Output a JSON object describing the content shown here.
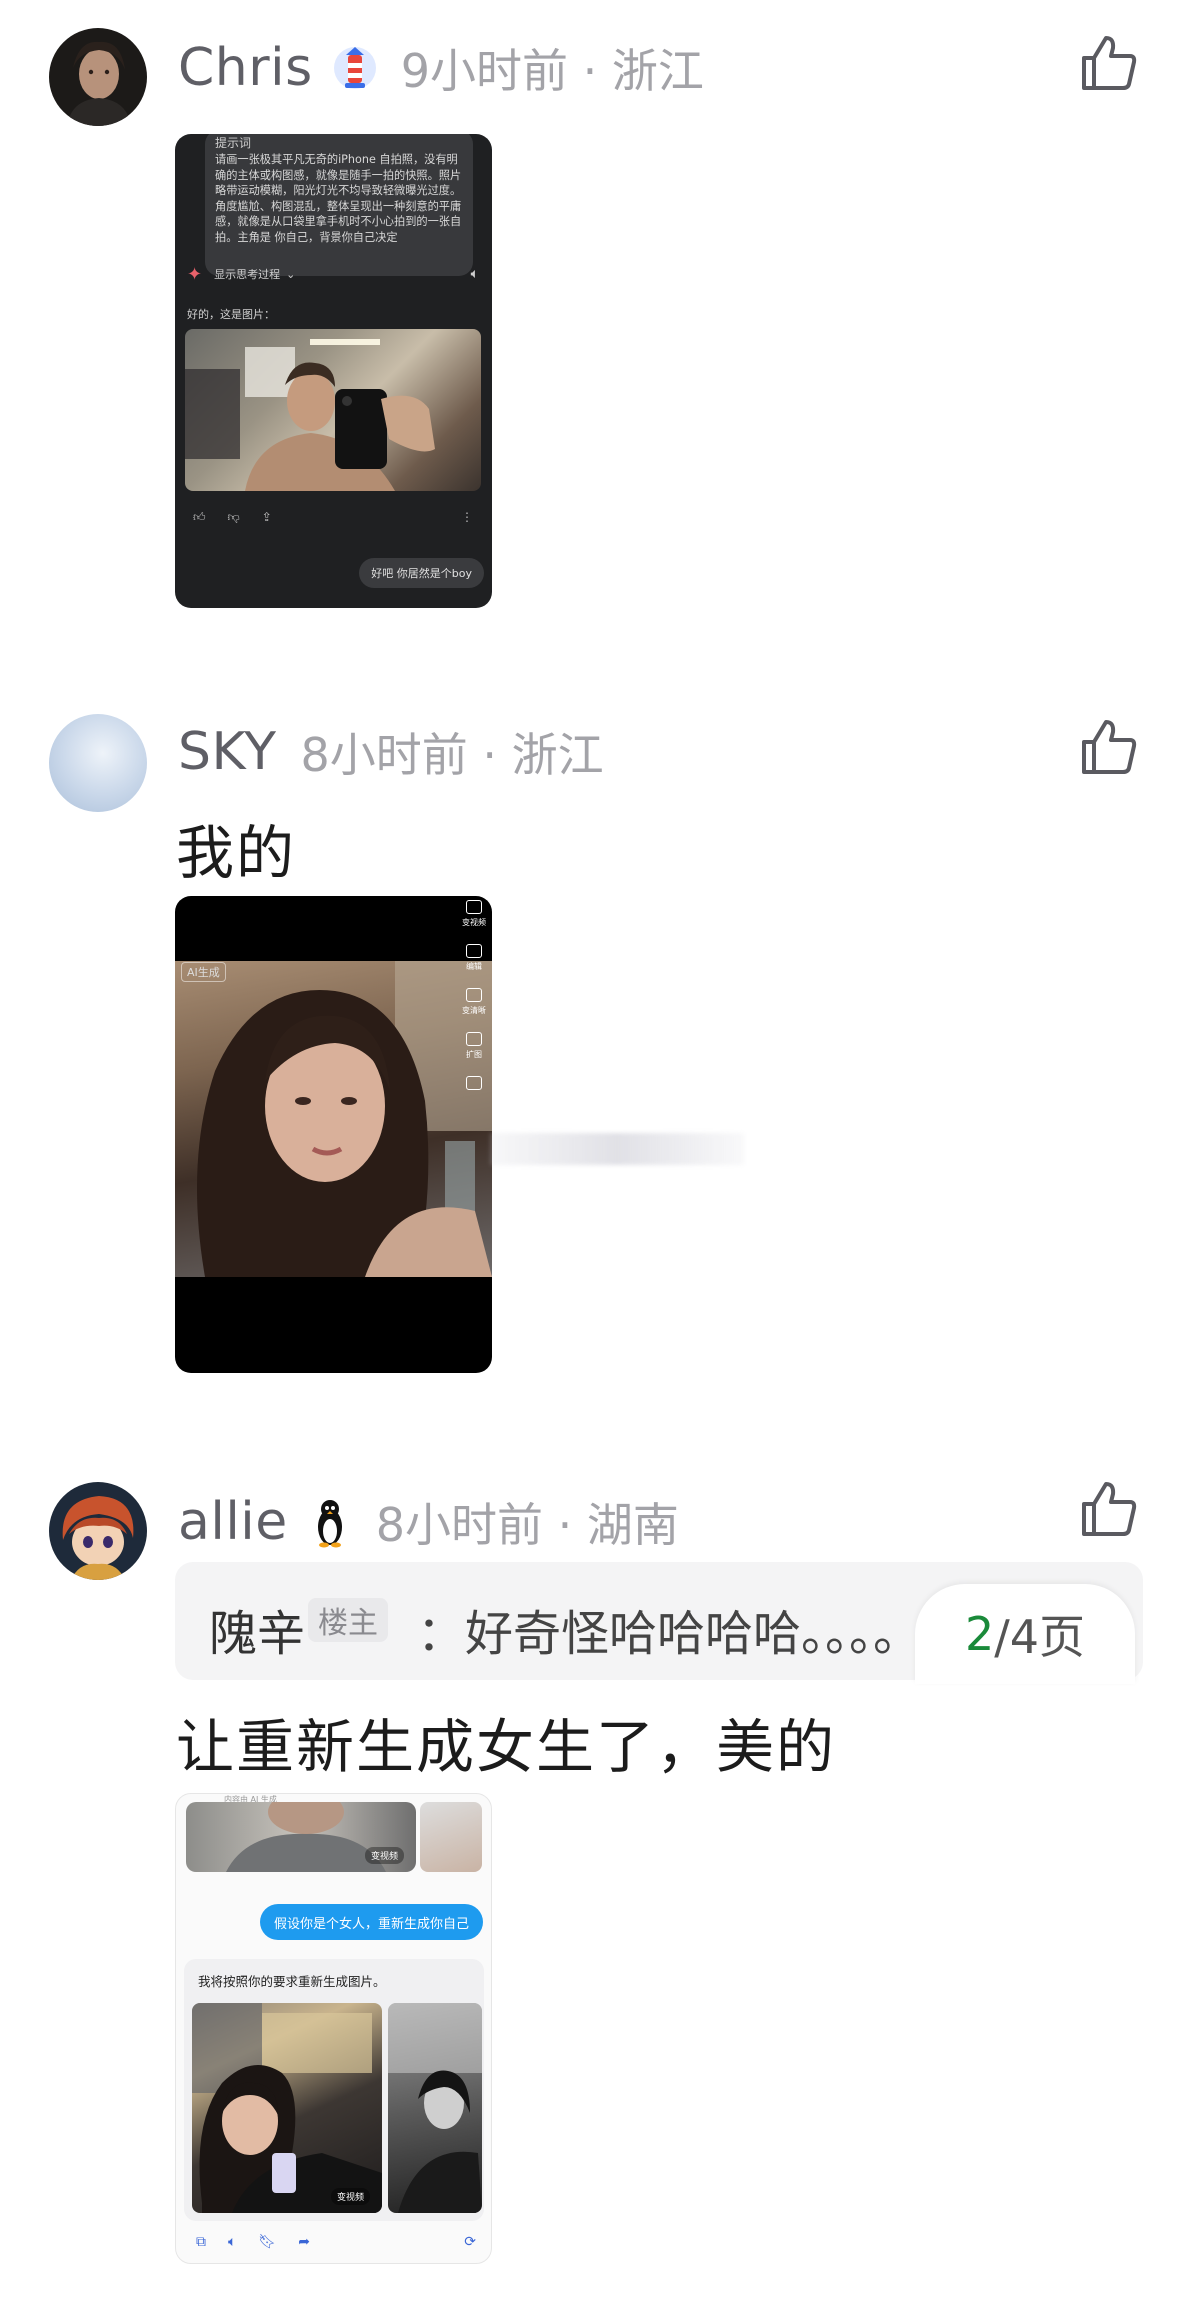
{
  "comments": [
    {
      "username": "Chris",
      "badge_icon": "lighthouse-badge-icon",
      "meta": "9小时前 · 浙江",
      "attachment": {
        "prompt_title": "提示词",
        "prompt_text": "请画一张极其平凡无奇的iPhone 自拍照，没有明确的主体或构图感，就像是随手一拍的快照。照片略带运动模糊，阳光灯光不均导致轻微曝光过度。角度尴尬、构图混乱，整体呈现出一种刻意的平庸感，就像是从口袋里拿手机时不小心拍到的一张自拍。主角是 你自己，背景你自己决定",
        "think_label": "显示思考过程",
        "reply_line": "好的，这是图片：",
        "user_reply": "好吧 你居然是个boy"
      }
    },
    {
      "username": "SKY",
      "meta": "8小时前 · 浙江",
      "text": "我的",
      "attachment": {
        "ai_tag": "AI生成",
        "tools": [
          "变视频",
          "编辑",
          "变清晰",
          "扩图",
          ""
        ]
      }
    },
    {
      "username": "allie",
      "badge_icon": "penguin-badge-icon",
      "meta": "8小时前 · 湖南",
      "reply": {
        "author": "隗辛",
        "host_badge": "楼主",
        "text": "：好奇怪哈哈哈哈。。。。",
        "pager_current": "2",
        "pager_total": "/4页"
      },
      "text": "让重新生成女生了，美的",
      "attachment": {
        "top_small_text": "内容由 AI 生成",
        "top_chip": "变视频",
        "user_bubble": "假设你是个女人，重新生成你自己",
        "reply_text": "我将按照你的要求重新生成图片。",
        "img_chip": "变视频"
      }
    }
  ]
}
